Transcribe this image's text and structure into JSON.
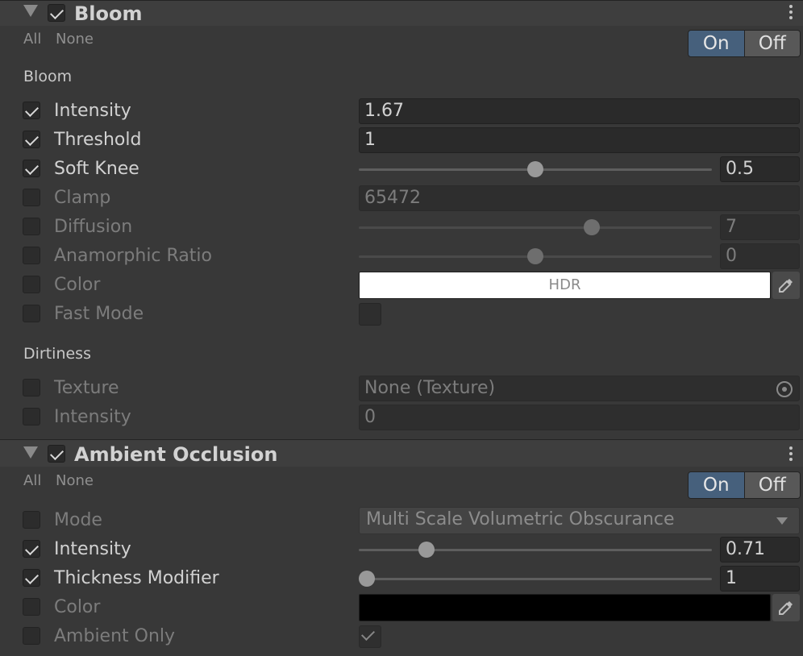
{
  "bloom": {
    "title": "Bloom",
    "all": "All",
    "none": "None",
    "toggle_on": "On",
    "toggle_off": "Off",
    "group_bloom": "Bloom",
    "group_dirtiness": "Dirtiness",
    "intensity_label": "Intensity",
    "intensity_value": "1.67",
    "threshold_label": "Threshold",
    "threshold_value": "1",
    "soft_knee_label": "Soft Knee",
    "soft_knee_value": "0.5",
    "soft_knee_fraction": 0.5,
    "clamp_label": "Clamp",
    "clamp_value": "65472",
    "diffusion_label": "Diffusion",
    "diffusion_value": "7",
    "anamorphic_label": "Anamorphic Ratio",
    "anamorphic_value": "0",
    "color_label": "Color",
    "color_hdr": "HDR",
    "fast_mode_label": "Fast Mode",
    "texture_label": "Texture",
    "texture_value": "None (Texture)",
    "dirt_intensity_label": "Intensity",
    "dirt_intensity_value": "0"
  },
  "ao": {
    "title": "Ambient Occlusion",
    "all": "All",
    "none": "None",
    "toggle_on": "On",
    "toggle_off": "Off",
    "mode_label": "Mode",
    "mode_value": "Multi Scale Volumetric Obscurance",
    "intensity_label": "Intensity",
    "intensity_value": "0.71",
    "thickness_label": "Thickness Modifier",
    "thickness_value": "1",
    "color_label": "Color",
    "ambient_only_label": "Ambient Only"
  },
  "colors": {
    "accent": "#46607c",
    "bloom_color": "#ffffff",
    "ao_color": "#000000"
  }
}
